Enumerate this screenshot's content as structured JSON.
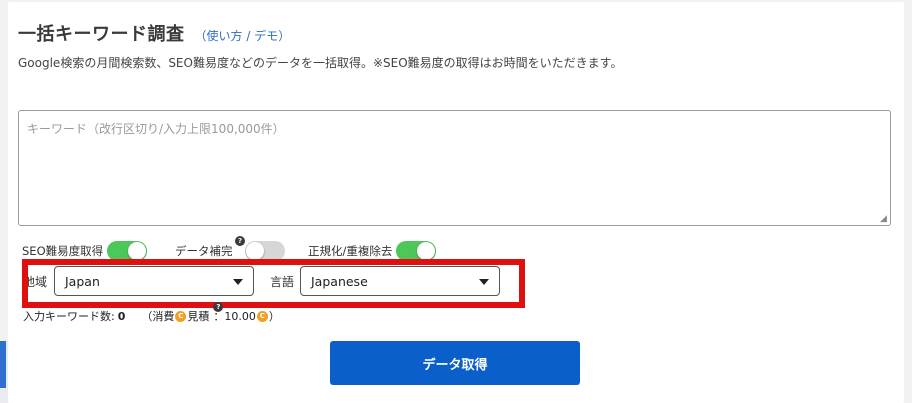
{
  "header": {
    "title": "一括キーワード調査",
    "links_open": "（",
    "usage_link": "使い方",
    "separator": " / ",
    "demo_link": "デモ",
    "links_close": "）"
  },
  "description": "Google検索の月間検索数、SEO難易度などのデータを一括取得。※SEO難易度の取得はお時間をいただきます。",
  "keyword_input": {
    "placeholder": "キーワード（改行区切り/入力上限100,000件）",
    "value": ""
  },
  "toggles": [
    {
      "label": "SEO難易度取得",
      "state": "on"
    },
    {
      "label": "データ補完",
      "state": "off"
    },
    {
      "label": "正規化/重複除去",
      "state": "on"
    }
  ],
  "region": {
    "label": "地域",
    "selected": "Japan"
  },
  "language": {
    "label": "言語",
    "selected": "Japanese"
  },
  "counts": {
    "input_label": "入力キーワード数:",
    "input_value": "0",
    "consume_open": "（消費",
    "coin_symbol": "C",
    "estimate_label": "見積",
    "info_symbol": "?",
    "colon": "：",
    "estimate_value": "10.00",
    "close": "）"
  },
  "submit_label": "データ取得",
  "colors": {
    "primary_button": "#0a5fcb",
    "toggle_on": "#4cc85a",
    "toggle_off": "#d6d6d6",
    "highlight": "#e01010",
    "coin": "#f0a020",
    "link": "#2d6cc8"
  }
}
